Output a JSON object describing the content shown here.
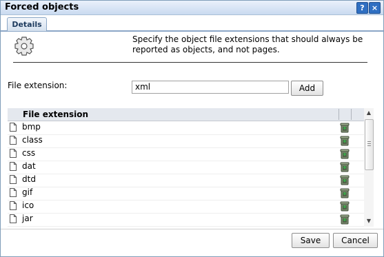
{
  "window": {
    "title": "Forced objects",
    "help_label": "?",
    "close_label": "×"
  },
  "tabs": [
    {
      "label": "Details"
    }
  ],
  "description": "Specify the object file extensions that should always be reported as objects, and not pages.",
  "form": {
    "label": "File extension:",
    "value": "xml",
    "add_label": "Add"
  },
  "grid": {
    "column_header": "File extension",
    "rows": [
      {
        "name": "bmp"
      },
      {
        "name": "class"
      },
      {
        "name": "css"
      },
      {
        "name": "dat"
      },
      {
        "name": "dtd"
      },
      {
        "name": "gif"
      },
      {
        "name": "ico"
      },
      {
        "name": "jar"
      }
    ]
  },
  "footer": {
    "save_label": "Save",
    "cancel_label": "Cancel"
  },
  "colors": {
    "title_bar": "#c9daf0",
    "accent": "#2f6fc2",
    "grid_header": "#e4e8ee"
  }
}
